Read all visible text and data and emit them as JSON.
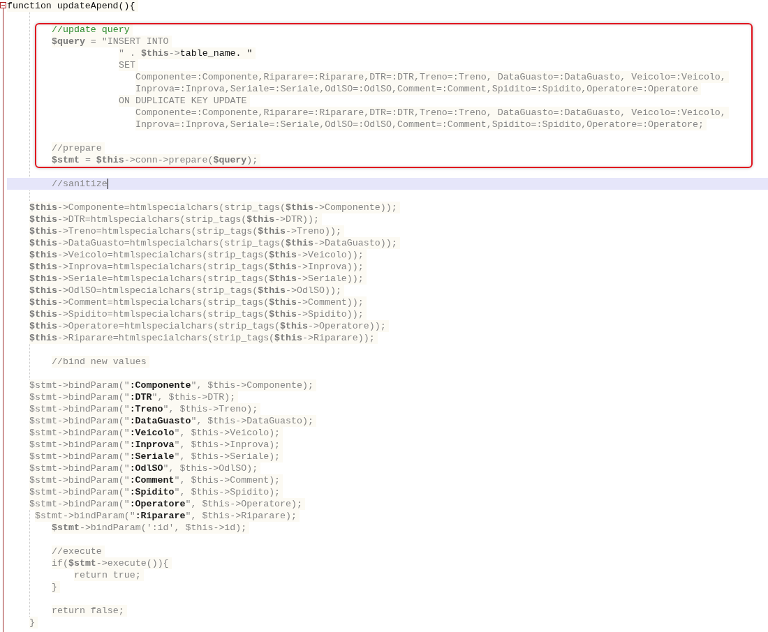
{
  "editor": {
    "fold_expanded": true,
    "blocks": [
      {
        "kind": "plain",
        "lines": [
          {
            "kind": "code",
            "current": false,
            "segments": [
              {
                "kind": "kw",
                "text": "function updateApend(){"
              }
            ]
          },
          {
            "kind": "blank"
          }
        ]
      },
      {
        "kind": "framed",
        "lines": [
          {
            "kind": "code",
            "current": false,
            "segments": [
              {
                "kind": "cm",
                "text": "        //update query"
              }
            ]
          },
          {
            "kind": "code",
            "current": false,
            "segments": [
              {
                "kind": "vr",
                "text": "        $query"
              },
              {
                "kind": "tx",
                "text": " = \"INSERT INTO"
              }
            ]
          },
          {
            "kind": "code",
            "current": false,
            "segments": [
              {
                "kind": "tx",
                "text": "                    \" . "
              },
              {
                "kind": "vr",
                "text": "$this"
              },
              {
                "kind": "tx",
                "text": "->"
              },
              {
                "kind": "kw",
                "text": "table_name. \""
              }
            ]
          },
          {
            "kind": "code",
            "current": false,
            "segments": [
              {
                "kind": "tx",
                "text": "                    SET"
              }
            ]
          },
          {
            "kind": "code",
            "current": false,
            "segments": [
              {
                "kind": "tx",
                "text": "                       Componente=:Componente,Riparare=:Riparare,DTR=:DTR,Treno=:Treno, DataGuasto=:DataGuasto, Veicolo=:Veicolo,"
              }
            ]
          },
          {
            "kind": "code",
            "current": false,
            "segments": [
              {
                "kind": "tx",
                "text": "                       Inprova=:Inprova,Seriale=:Seriale,OdlSO=:OdlSO,Comment=:Comment,Spidito=:Spidito,Operatore=:Operatore"
              }
            ]
          },
          {
            "kind": "code",
            "current": false,
            "segments": [
              {
                "kind": "tx",
                "text": "                    ON DUPLICATE KEY UPDATE"
              }
            ]
          },
          {
            "kind": "code",
            "current": false,
            "segments": [
              {
                "kind": "tx",
                "text": "                       Componente=:Componente,Riparare=:Riparare,DTR=:DTR,Treno=:Treno, DataGuasto=:DataGuasto, Veicolo=:Veicolo,"
              }
            ]
          },
          {
            "kind": "code",
            "current": false,
            "segments": [
              {
                "kind": "tx",
                "text": "                       Inprova=:Inprova,Seriale=:Seriale,OdlSO=:OdlSO,Comment=:Comment,Spidito=:Spidito,Operatore=:Operatore;"
              }
            ]
          },
          {
            "kind": "blank"
          },
          {
            "kind": "code",
            "current": false,
            "segments": [
              {
                "kind": "tx",
                "text": "        //prepare"
              }
            ]
          },
          {
            "kind": "code",
            "current": false,
            "segments": [
              {
                "kind": "vr",
                "text": "        $stmt"
              },
              {
                "kind": "tx",
                "text": " = "
              },
              {
                "kind": "vr",
                "text": "$this"
              },
              {
                "kind": "tx",
                "text": "->conn->prepare("
              },
              {
                "kind": "vr",
                "text": "$query"
              },
              {
                "kind": "tx",
                "text": ");"
              }
            ]
          }
        ]
      },
      {
        "kind": "plain",
        "lines": [
          {
            "kind": "blank"
          },
          {
            "kind": "code",
            "current": true,
            "segments": [
              {
                "kind": "tx",
                "text": "        //sanitize"
              }
            ]
          },
          {
            "kind": "blank"
          },
          {
            "kind": "code",
            "current": false,
            "segments": [
              {
                "kind": "vr",
                "text": "    $this"
              },
              {
                "kind": "tx",
                "text": "->Componente=htmlspecialchars(strip_tags("
              },
              {
                "kind": "vr",
                "text": "$this"
              },
              {
                "kind": "tx",
                "text": "->Componente));"
              }
            ]
          },
          {
            "kind": "code",
            "current": false,
            "segments": [
              {
                "kind": "vr",
                "text": "    $this"
              },
              {
                "kind": "tx",
                "text": "->DTR=htmlspecialchars(strip_tags("
              },
              {
                "kind": "vr",
                "text": "$this"
              },
              {
                "kind": "tx",
                "text": "->DTR));"
              }
            ]
          },
          {
            "kind": "code",
            "current": false,
            "segments": [
              {
                "kind": "vr",
                "text": "    $this"
              },
              {
                "kind": "tx",
                "text": "->Treno=htmlspecialchars(strip_tags("
              },
              {
                "kind": "vr",
                "text": "$this"
              },
              {
                "kind": "tx",
                "text": "->Treno));"
              }
            ]
          },
          {
            "kind": "code",
            "current": false,
            "segments": [
              {
                "kind": "vr",
                "text": "    $this"
              },
              {
                "kind": "tx",
                "text": "->DataGuasto=htmlspecialchars(strip_tags("
              },
              {
                "kind": "vr",
                "text": "$this"
              },
              {
                "kind": "tx",
                "text": "->DataGuasto));"
              }
            ]
          },
          {
            "kind": "code",
            "current": false,
            "segments": [
              {
                "kind": "vr",
                "text": "    $this"
              },
              {
                "kind": "tx",
                "text": "->Veicolo=htmlspecialchars(strip_tags("
              },
              {
                "kind": "vr",
                "text": "$this"
              },
              {
                "kind": "tx",
                "text": "->Veicolo));"
              }
            ]
          },
          {
            "kind": "code",
            "current": false,
            "segments": [
              {
                "kind": "vr",
                "text": "    $this"
              },
              {
                "kind": "tx",
                "text": "->Inprova=htmlspecialchars(strip_tags("
              },
              {
                "kind": "vr",
                "text": "$this"
              },
              {
                "kind": "tx",
                "text": "->Inprova));"
              }
            ]
          },
          {
            "kind": "code",
            "current": false,
            "segments": [
              {
                "kind": "vr",
                "text": "    $this"
              },
              {
                "kind": "tx",
                "text": "->Seriale=htmlspecialchars(strip_tags("
              },
              {
                "kind": "vr",
                "text": "$this"
              },
              {
                "kind": "tx",
                "text": "->Seriale));"
              }
            ]
          },
          {
            "kind": "code",
            "current": false,
            "segments": [
              {
                "kind": "vr",
                "text": "    $this"
              },
              {
                "kind": "tx",
                "text": "->OdlSO=htmlspecialchars(strip_tags("
              },
              {
                "kind": "vr",
                "text": "$this"
              },
              {
                "kind": "tx",
                "text": "->OdlSO));"
              }
            ]
          },
          {
            "kind": "code",
            "current": false,
            "segments": [
              {
                "kind": "vr",
                "text": "    $this"
              },
              {
                "kind": "tx",
                "text": "->Comment=htmlspecialchars(strip_tags("
              },
              {
                "kind": "vr",
                "text": "$this"
              },
              {
                "kind": "tx",
                "text": "->Comment));"
              }
            ]
          },
          {
            "kind": "code",
            "current": false,
            "segments": [
              {
                "kind": "vr",
                "text": "    $this"
              },
              {
                "kind": "tx",
                "text": "->Spidito=htmlspecialchars(strip_tags("
              },
              {
                "kind": "vr",
                "text": "$this"
              },
              {
                "kind": "tx",
                "text": "->Spidito));"
              }
            ]
          },
          {
            "kind": "code",
            "current": false,
            "segments": [
              {
                "kind": "vr",
                "text": "    $this"
              },
              {
                "kind": "tx",
                "text": "->Operatore=htmlspecialchars(strip_tags("
              },
              {
                "kind": "vr",
                "text": "$this"
              },
              {
                "kind": "tx",
                "text": "->Operatore));"
              }
            ]
          },
          {
            "kind": "code",
            "current": false,
            "segments": [
              {
                "kind": "vr",
                "text": "    $this"
              },
              {
                "kind": "tx",
                "text": "->Riparare=htmlspecialchars(strip_tags("
              },
              {
                "kind": "vr",
                "text": "$this"
              },
              {
                "kind": "tx",
                "text": "->Riparare));"
              }
            ]
          },
          {
            "kind": "blank"
          },
          {
            "kind": "code",
            "current": false,
            "segments": [
              {
                "kind": "tx",
                "text": "        //bind new values"
              }
            ]
          },
          {
            "kind": "blank"
          },
          {
            "kind": "code",
            "current": false,
            "segments": [
              {
                "kind": "tx",
                "text": "    $stmt->bindParam(\""
              },
              {
                "kind": "pm",
                "text": ":Componente"
              },
              {
                "kind": "tx",
                "text": "\", $this->Componente);"
              }
            ]
          },
          {
            "kind": "code",
            "current": false,
            "segments": [
              {
                "kind": "tx",
                "text": "    $stmt->bindParam(\""
              },
              {
                "kind": "pm",
                "text": ":DTR"
              },
              {
                "kind": "tx",
                "text": "\", $this->DTR);"
              }
            ]
          },
          {
            "kind": "code",
            "current": false,
            "segments": [
              {
                "kind": "tx",
                "text": "    $stmt->bindParam(\""
              },
              {
                "kind": "pm",
                "text": ":Treno"
              },
              {
                "kind": "tx",
                "text": "\", $this->Treno);"
              }
            ]
          },
          {
            "kind": "code",
            "current": false,
            "segments": [
              {
                "kind": "tx",
                "text": "    $stmt->bindParam(\""
              },
              {
                "kind": "pm",
                "text": ":DataGuasto"
              },
              {
                "kind": "tx",
                "text": "\", $this->DataGuasto);"
              }
            ]
          },
          {
            "kind": "code",
            "current": false,
            "segments": [
              {
                "kind": "tx",
                "text": "    $stmt->bindParam(\""
              },
              {
                "kind": "pm",
                "text": ":Veicolo"
              },
              {
                "kind": "tx",
                "text": "\", $this->Veicolo);"
              }
            ]
          },
          {
            "kind": "code",
            "current": false,
            "segments": [
              {
                "kind": "tx",
                "text": "    $stmt->bindParam(\""
              },
              {
                "kind": "pm",
                "text": ":Inprova"
              },
              {
                "kind": "tx",
                "text": "\", $this->Inprova);"
              }
            ]
          },
          {
            "kind": "code",
            "current": false,
            "segments": [
              {
                "kind": "tx",
                "text": "    $stmt->bindParam(\""
              },
              {
                "kind": "pm",
                "text": ":Seriale"
              },
              {
                "kind": "tx",
                "text": "\", $this->Seriale);"
              }
            ]
          },
          {
            "kind": "code",
            "current": false,
            "segments": [
              {
                "kind": "tx",
                "text": "    $stmt->bindParam(\""
              },
              {
                "kind": "pm",
                "text": ":OdlSO"
              },
              {
                "kind": "tx",
                "text": "\", $this->OdlSO);"
              }
            ]
          },
          {
            "kind": "code",
            "current": false,
            "segments": [
              {
                "kind": "tx",
                "text": "    $stmt->bindParam(\""
              },
              {
                "kind": "pm",
                "text": ":Comment"
              },
              {
                "kind": "tx",
                "text": "\", $this->Comment);"
              }
            ]
          },
          {
            "kind": "code",
            "current": false,
            "segments": [
              {
                "kind": "tx",
                "text": "    $stmt->bindParam(\""
              },
              {
                "kind": "pm",
                "text": ":Spidito"
              },
              {
                "kind": "tx",
                "text": "\", $this->Spidito);"
              }
            ]
          },
          {
            "kind": "code",
            "current": false,
            "segments": [
              {
                "kind": "tx",
                "text": "    $stmt->bindParam(\""
              },
              {
                "kind": "pm",
                "text": ":Operatore"
              },
              {
                "kind": "tx",
                "text": "\", $this->Operatore);"
              }
            ]
          },
          {
            "kind": "code",
            "current": false,
            "segments": [
              {
                "kind": "tx",
                "text": "     $stmt->bindParam(\""
              },
              {
                "kind": "pm",
                "text": ":Riparare"
              },
              {
                "kind": "tx",
                "text": "\", $this->Riparare);"
              }
            ]
          },
          {
            "kind": "code",
            "current": false,
            "segments": [
              {
                "kind": "vr",
                "text": "        $stmt"
              },
              {
                "kind": "tx",
                "text": "->bindParam(':id', $this->id);"
              }
            ]
          },
          {
            "kind": "blank"
          },
          {
            "kind": "code",
            "current": false,
            "segments": [
              {
                "kind": "tx",
                "text": "        //execute"
              }
            ]
          },
          {
            "kind": "code",
            "current": false,
            "segments": [
              {
                "kind": "tx",
                "text": "        if("
              },
              {
                "kind": "vr",
                "text": "$stmt"
              },
              {
                "kind": "tx",
                "text": "->execute()){"
              }
            ]
          },
          {
            "kind": "code",
            "current": false,
            "segments": [
              {
                "kind": "tx",
                "text": "            return true;"
              }
            ]
          },
          {
            "kind": "code",
            "current": false,
            "segments": [
              {
                "kind": "tx",
                "text": "        }"
              }
            ]
          },
          {
            "kind": "blank"
          },
          {
            "kind": "code",
            "current": false,
            "segments": [
              {
                "kind": "tx",
                "text": "        return false;"
              }
            ]
          },
          {
            "kind": "code",
            "current": false,
            "segments": [
              {
                "kind": "tx",
                "text": "    }"
              }
            ]
          }
        ]
      }
    ]
  }
}
